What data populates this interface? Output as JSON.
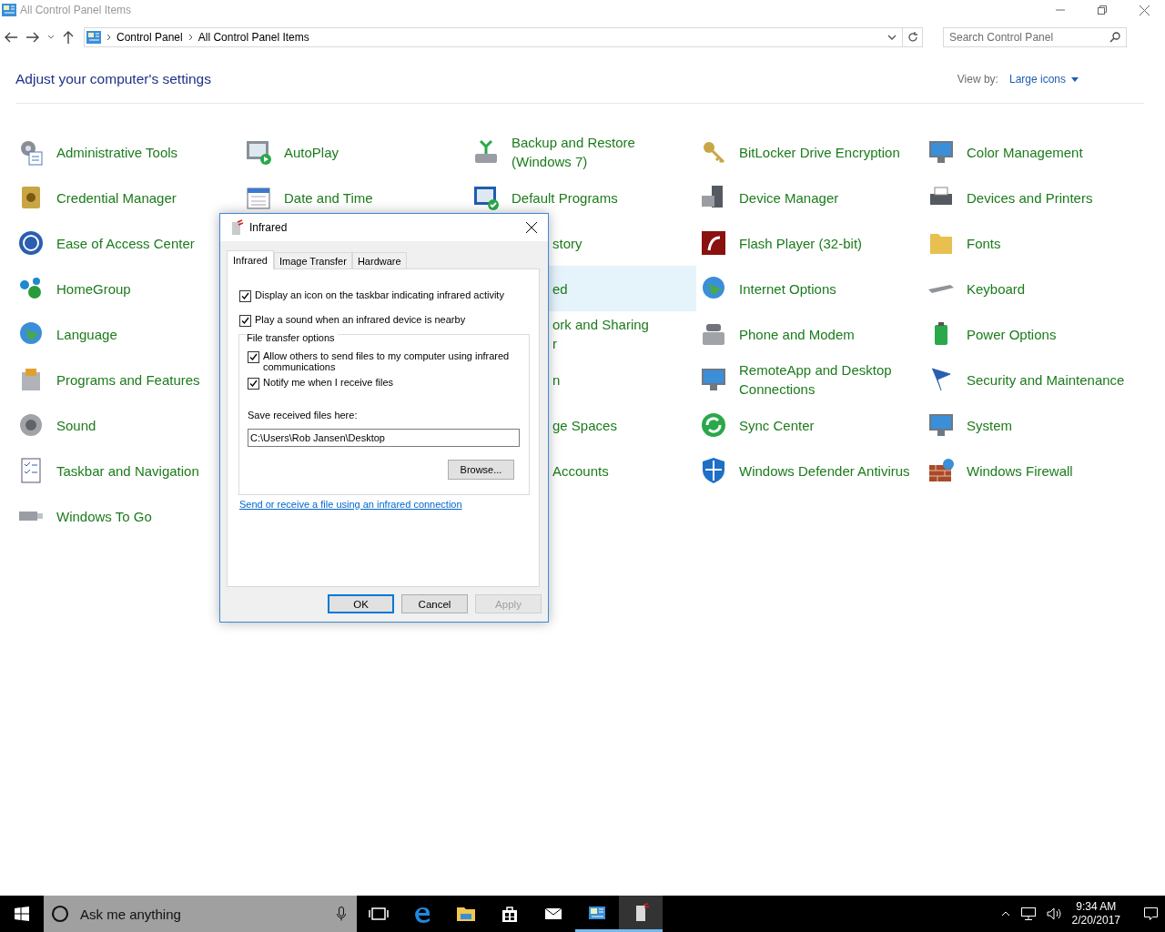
{
  "window": {
    "title": "All Control Panel Items"
  },
  "address": {
    "crumbs": [
      "Control Panel",
      "All Control Panel Items"
    ]
  },
  "search": {
    "placeholder": "Search Control Panel"
  },
  "header": {
    "title": "Adjust your computer's settings",
    "view_by_label": "View by:",
    "view_by_value": "Large icons"
  },
  "columns": [
    {
      "items": [
        {
          "kind": "full",
          "label": "Administrative Tools",
          "highlighted": false
        },
        {
          "kind": "full",
          "label": "Credential Manager",
          "highlighted": false
        },
        {
          "kind": "full",
          "label": "Ease of Access Center",
          "highlighted": false
        },
        {
          "kind": "full",
          "label": "HomeGroup",
          "highlighted": false
        },
        {
          "kind": "full",
          "label": "Language",
          "highlighted": false
        },
        {
          "kind": "full",
          "label": "Programs and Features",
          "highlighted": false
        },
        {
          "kind": "full",
          "label": "Sound",
          "highlighted": false
        },
        {
          "kind": "full",
          "label": "Taskbar and Navigation",
          "highlighted": false
        },
        {
          "kind": "full",
          "label": "Windows To Go",
          "highlighted": false
        }
      ]
    },
    {
      "items": [
        {
          "kind": "full",
          "label": "AutoPlay",
          "highlighted": false
        },
        {
          "kind": "full",
          "label": "Date and Time",
          "highlighted": false
        }
      ]
    },
    {
      "items": [
        {
          "kind": "full",
          "label": "Backup and Restore (Windows 7)",
          "highlighted": false
        },
        {
          "kind": "full",
          "label": "Default Programs",
          "highlighted": false
        },
        {
          "kind": "partial",
          "label": "story",
          "highlighted": false
        },
        {
          "kind": "partial",
          "label": "ed",
          "highlighted": true
        },
        {
          "kind": "partial",
          "label": "ork and Sharing",
          "label_2": "r",
          "highlighted": false
        },
        {
          "kind": "partial",
          "label": "n",
          "highlighted": false
        },
        {
          "kind": "partial",
          "label": "ge Spaces",
          "highlighted": false
        },
        {
          "kind": "partial",
          "label": "Accounts",
          "highlighted": false
        }
      ]
    },
    {
      "items": [
        {
          "kind": "full",
          "label": "BitLocker Drive Encryption",
          "highlighted": false
        },
        {
          "kind": "full",
          "label": "Device Manager",
          "highlighted": false
        },
        {
          "kind": "full",
          "label": "Flash Player (32-bit)",
          "highlighted": false
        },
        {
          "kind": "full",
          "label": "Internet Options",
          "highlighted": false
        },
        {
          "kind": "full",
          "label": "Phone and Modem",
          "highlighted": false
        },
        {
          "kind": "full",
          "label": "RemoteApp and Desktop Connections",
          "highlighted": false
        },
        {
          "kind": "full",
          "label": "Sync Center",
          "highlighted": false
        },
        {
          "kind": "full",
          "label": "Windows Defender Antivirus",
          "highlighted": false
        }
      ]
    },
    {
      "items": [
        {
          "kind": "full",
          "label": "Color Management",
          "highlighted": false
        },
        {
          "kind": "full",
          "label": "Devices and Printers",
          "highlighted": false
        },
        {
          "kind": "full",
          "label": "Fonts",
          "highlighted": false
        },
        {
          "kind": "full",
          "label": "Keyboard",
          "highlighted": false
        },
        {
          "kind": "full",
          "label": "Power Options",
          "highlighted": false
        },
        {
          "kind": "full",
          "label": "Security and Maintenance",
          "highlighted": false
        },
        {
          "kind": "full",
          "label": "System",
          "highlighted": false
        },
        {
          "kind": "full",
          "label": "Windows Firewall",
          "highlighted": false
        }
      ]
    }
  ],
  "dialog": {
    "title": "Infrared",
    "tabs": [
      {
        "label": "Infrared",
        "selected": true
      },
      {
        "label": "Image Transfer",
        "selected": false
      },
      {
        "label": "Hardware",
        "selected": false
      }
    ],
    "options": [
      {
        "label": "Display an icon on the taskbar indicating infrared activity",
        "checked": true
      },
      {
        "label": "Play a sound when an infrared device is nearby",
        "checked": true
      }
    ],
    "group": {
      "title": "File transfer options",
      "options": [
        {
          "label": "Allow others to send files to my computer using infrared communications",
          "checked": true
        },
        {
          "label": "Notify me when I receive files",
          "checked": true
        }
      ],
      "save_label": "Save received files here:",
      "save_path": "C:\\Users\\Rob Jansen\\Desktop",
      "browse": "Browse..."
    },
    "link": "Send or receive a file using an infrared connection",
    "buttons": [
      {
        "label": "OK",
        "default": true,
        "disabled": false
      },
      {
        "label": "Cancel",
        "default": false,
        "disabled": false
      },
      {
        "label": "Apply",
        "default": false,
        "disabled": true
      }
    ]
  },
  "taskbar": {
    "search_placeholder": "Ask me anything",
    "apps": [
      {
        "kind": "task-view",
        "active": false
      },
      {
        "kind": "edge",
        "active": false
      },
      {
        "kind": "explorer",
        "active": false
      },
      {
        "kind": "store",
        "active": false
      },
      {
        "kind": "mail",
        "active": false
      },
      {
        "kind": "control-panel",
        "active": true
      },
      {
        "kind": "infrared",
        "active": true
      }
    ],
    "time": "9:34 AM",
    "date": "2/20/2017"
  }
}
